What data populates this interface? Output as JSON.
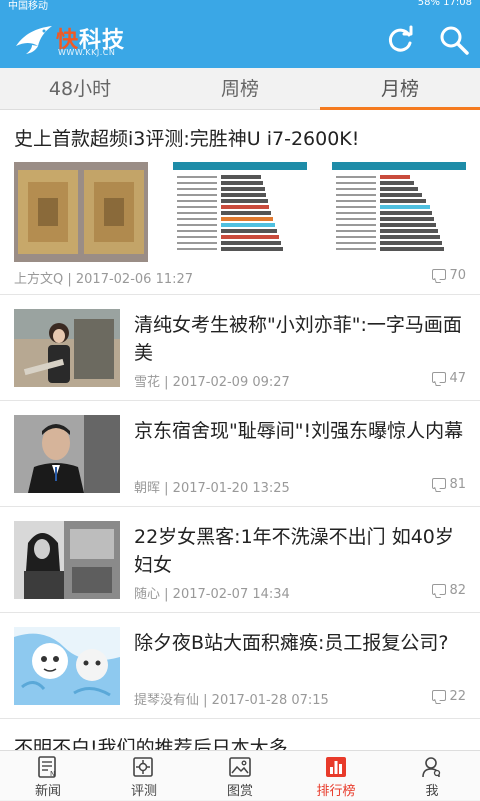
{
  "status": {
    "carrier": "中国移动",
    "battery": "58%",
    "time": "17:08"
  },
  "app": {
    "name_part1": "快",
    "name_part2": "科技",
    "url": "WWW.KKJ.CN"
  },
  "tabs": [
    {
      "label": "48小时"
    },
    {
      "label": "周榜"
    },
    {
      "label": "月榜"
    }
  ],
  "active_tab": "月榜",
  "featured": {
    "title": "史上首款超频i3评测:完胜神U i7-2600K!",
    "author": "上方文Q",
    "date": "2017-02-06 11:27",
    "comments": "70"
  },
  "articles": [
    {
      "title": "清纯女考生被称\"小刘亦菲\":一字马画面美",
      "author": "雪花",
      "date": "2017-02-09 09:27",
      "comments": "47"
    },
    {
      "title": "京东宿舍现\"耻辱间\"!刘强东曝惊人内幕",
      "author": "朝晖",
      "date": "2017-01-20 13:25",
      "comments": "81"
    },
    {
      "title": "22岁女黑客:1年不洗澡不出门 如40岁妇女",
      "author": "随心",
      "date": "2017-02-07 14:34",
      "comments": "82"
    },
    {
      "title": "除夕夜B站大面积瘫痪:员工报复公司?",
      "author": "提琴没有仙",
      "date": "2017-01-28 07:15",
      "comments": "22"
    }
  ],
  "partial_title": "不明不白!我们的推荐后日本大多",
  "bottom_nav": [
    {
      "label": "新闻"
    },
    {
      "label": "评测"
    },
    {
      "label": "图赏"
    },
    {
      "label": "排行榜"
    },
    {
      "label": "我"
    }
  ],
  "colors": {
    "primary": "#3aa7e6",
    "accent": "#f57a1f",
    "nav_active": "#e83a2a"
  }
}
